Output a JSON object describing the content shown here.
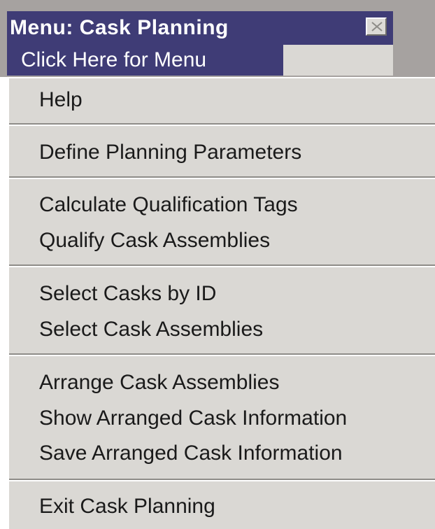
{
  "window": {
    "title": "Menu: Cask Planning",
    "close_icon": "close-icon"
  },
  "menu_header": {
    "label": "Click Here for Menu"
  },
  "colors": {
    "titlebar": "#3f3c76",
    "menu_bg": "#dad8d4",
    "text": "#1a1a1a",
    "title_text": "#ffffff"
  },
  "menu": {
    "items": [
      {
        "label": "Help"
      },
      {
        "label": "Define Planning Parameters"
      },
      {
        "label": "Calculate Qualification Tags"
      },
      {
        "label": "Qualify Cask Assemblies"
      },
      {
        "label": "Select Casks by ID"
      },
      {
        "label": "Select Cask Assemblies"
      },
      {
        "label": "Arrange Cask Assemblies"
      },
      {
        "label": "Show Arranged Cask Information"
      },
      {
        "label": "Save Arranged Cask Information"
      },
      {
        "label": "Exit Cask Planning"
      }
    ]
  }
}
